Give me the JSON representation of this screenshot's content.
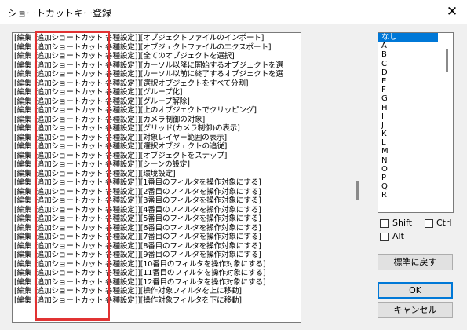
{
  "window": {
    "title": "ショートカットキー登録",
    "close_glyph": "✕"
  },
  "shortcut_list": {
    "rows": [
      "[編集 [追加ショートカット 各種設定]][オブジェクトファイルのインポート]",
      "[編集 [追加ショートカット 各種設定]][オブジェクトファイルのエクスポート]",
      "[編集 [追加ショートカット 各種設定]][全てのオブジェクトを選択]",
      "[編集 [追加ショートカット 各種設定]][カーソル以降に開始するオブジェクトを選",
      "[編集 [追加ショートカット 各種設定]][カーソル以前に終了するオブジェクトを選",
      "[編集 [追加ショートカット 各種設定]][選択オブジェクトをすべて分割]",
      "[編集 [追加ショートカット 各種設定]][グループ化]",
      "[編集 [追加ショートカット 各種設定]][グループ解除]",
      "[編集 [追加ショートカット 各種設定]][上のオブジェクトでクリッピング]",
      "[編集 [追加ショートカット 各種設定]][カメラ制御の対象]",
      "[編集 [追加ショートカット 各種設定]][グリッド(カメラ制御)の表示]",
      "[編集 [追加ショートカット 各種設定]][対象レイヤー範囲の表示]",
      "[編集 [追加ショートカット 各種設定]][選択オブジェクトの追従]",
      "[編集 [追加ショートカット 各種設定]][オブジェクトをスナップ]",
      "[編集 [追加ショートカット 各種設定]][シーンの設定]",
      "[編集 [追加ショートカット 各種設定]][環境設定]",
      "[編集 [追加ショートカット 各種設定]][1番目のフィルタを操作対象にする]",
      "[編集 [追加ショートカット 各種設定]][2番目のフィルタを操作対象にする]",
      "[編集 [追加ショートカット 各種設定]][3番目のフィルタを操作対象にする]",
      "[編集 [追加ショートカット 各種設定]][4番目のフィルタを操作対象にする]",
      "[編集 [追加ショートカット 各種設定]][5番目のフィルタを操作対象にする]",
      "[編集 [追加ショートカット 各種設定]][6番目のフィルタを操作対象にする]",
      "[編集 [追加ショートカット 各種設定]][7番目のフィルタを操作対象にする]",
      "[編集 [追加ショートカット 各種設定]][8番目のフィルタを操作対象にする]",
      "[編集 [追加ショートカット 各種設定]][9番目のフィルタを操作対象にする]",
      "[編集 [追加ショートカット 各種設定]][10番目のフィルタを操作対象にする]",
      "[編集 [追加ショートカット 各種設定]][11番目のフィルタを操作対象にする]",
      "[編集 [追加ショートカット 各種設定]][12番目のフィルタを操作対象にする]",
      "[編集 [追加ショートカット 各種設定]][操作対象フィルタを上に移動]",
      "[編集 [追加ショートカット 各種設定]][操作対象フィルタを下に移動]"
    ]
  },
  "key_list": {
    "items": [
      "なし",
      "A",
      "B",
      "C",
      "D",
      "E",
      "F",
      "G",
      "H",
      "I",
      "J",
      "K",
      "L",
      "M",
      "N",
      "O",
      "P",
      "Q",
      "R"
    ],
    "selected": "なし"
  },
  "modifiers": {
    "shift": "Shift",
    "ctrl": "Ctrl",
    "alt": "Alt"
  },
  "buttons": {
    "reset": "標準に戻す",
    "ok": "OK",
    "cancel": "キャンセル"
  },
  "colors": {
    "highlight": "#e13232",
    "selection": "#0078d7"
  }
}
